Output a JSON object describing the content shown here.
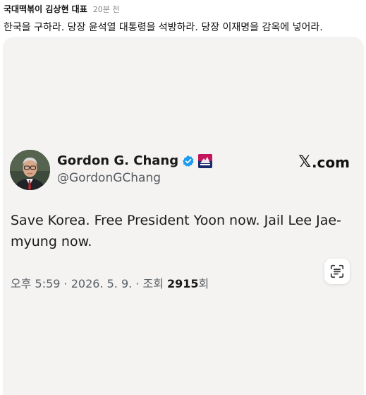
{
  "post": {
    "author": "국대떡볶이 김상현 대표",
    "time": "20분 전",
    "text": "한국을 구하라. 당장 윤석열 대통령을 석방하라. 당장 이재명을 감옥에 넣어라."
  },
  "tweet": {
    "display_name": "Gordon G. Chang",
    "handle": "@GordonGChang",
    "site_mark": "𝕏",
    "site_domain": ".com",
    "text": "Save Korea. Free President Yoon now. Jail Lee Jae-myung now.",
    "meta_prefix": "오후 5:59 · 2026. 5. 9. · 조회 ",
    "views": "2915",
    "meta_suffix": "회"
  },
  "colors": {
    "verified": "#1d9bf0",
    "card_background": "#f4f3f1",
    "cpac_badge": "#c2185b"
  },
  "icons": {
    "verified": "verified-badge-icon",
    "affiliation": "cpac-badge-icon",
    "lens": "text-scan-icon"
  }
}
